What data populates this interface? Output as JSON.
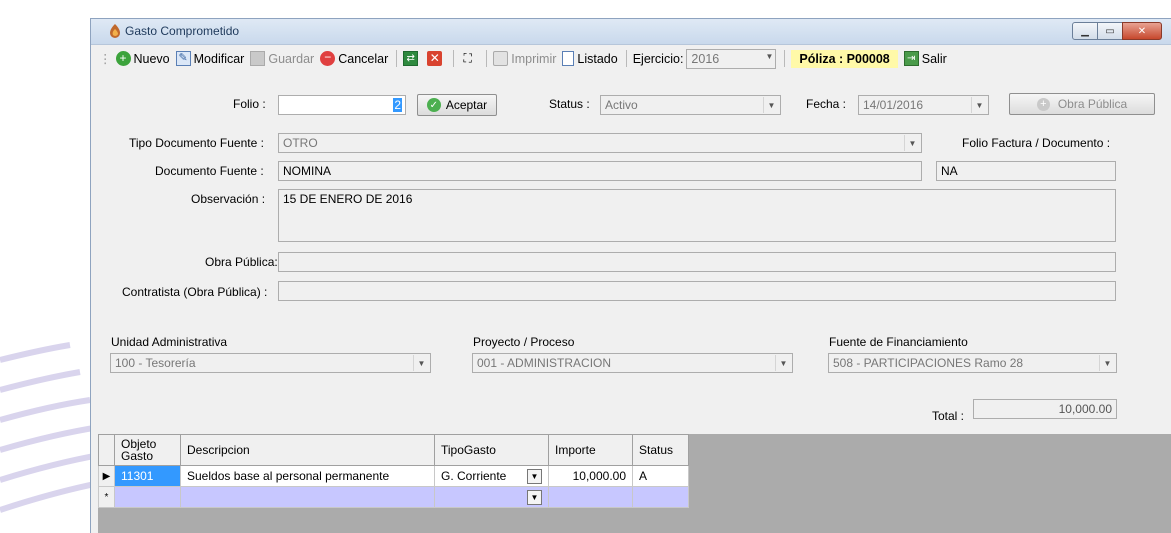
{
  "window": {
    "title": "Gasto Comprometido"
  },
  "toolbar": {
    "nuevo": "Nuevo",
    "modificar": "Modificar",
    "guardar": "Guardar",
    "cancelar": "Cancelar",
    "imprimir": "Imprimir",
    "listado": "Listado",
    "ejercicio_label": "Ejercicio:",
    "ejercicio_value": "2016",
    "poliza": "Póliza : P00008",
    "salir": "Salir"
  },
  "form": {
    "folio_label": "Folio :",
    "folio_value": "2",
    "aceptar": "Aceptar",
    "status_label": "Status :",
    "status_value": "Activo",
    "fecha_label": "Fecha :",
    "fecha_value": "14/01/2016",
    "obra_publica_button": "Obra Pública",
    "tipo_doc_label": "Tipo Documento Fuente :",
    "tipo_doc_value": "OTRO",
    "folio_factura_label": "Folio Factura / Documento :",
    "doc_fuente_label": "Documento Fuente :",
    "doc_fuente_value": "NOMINA",
    "folio_factura_value": "NA",
    "observacion_label": "Observación :",
    "observacion_value": "15 DE ENERO DE 2016",
    "obra_publica_label": "Obra Pública:",
    "obra_publica_value": "",
    "contratista_label": "Contratista (Obra Pública) :",
    "contratista_value": "",
    "unidad_label": "Unidad Administrativa",
    "unidad_value": "100 - Tesorería",
    "proyecto_label": "Proyecto / Proceso",
    "proyecto_value": "001 - ADMINISTRACION",
    "fuente_label": "Fuente de Financiamiento",
    "fuente_value": "508 - PARTICIPACIONES Ramo 28",
    "total_label": "Total :",
    "total_value": "10,000.00"
  },
  "grid": {
    "headers": {
      "objeto_line1": "Objeto",
      "objeto_line2": "Gasto",
      "descripcion": "Descripcion",
      "tipogasto": "TipoGasto",
      "importe": "Importe",
      "status": "Status"
    },
    "row": {
      "objeto": "11301",
      "descripcion": "Sueldos base al personal permanente",
      "tipogasto": "G. Corriente",
      "importe": "10,000.00",
      "status": "A"
    },
    "new_row_marker": "*"
  }
}
